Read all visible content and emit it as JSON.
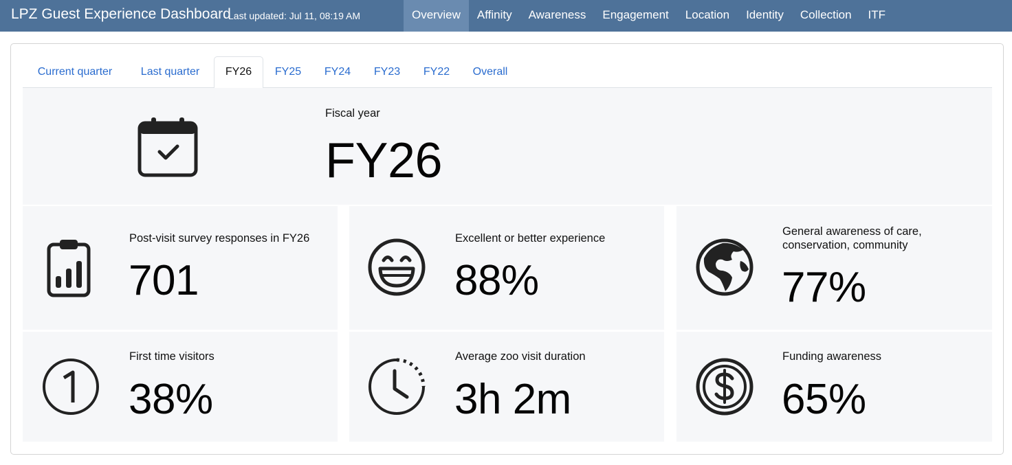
{
  "app": {
    "title": "LPZ Guest Experience Dashboard",
    "last_updated": "Last updated: Jul 11, 08:19 AM"
  },
  "nav": {
    "items": [
      {
        "label": "Overview",
        "active": true
      },
      {
        "label": "Affinity"
      },
      {
        "label": "Awareness"
      },
      {
        "label": "Engagement"
      },
      {
        "label": "Location"
      },
      {
        "label": "Identity"
      },
      {
        "label": "Collection"
      },
      {
        "label": "ITF"
      }
    ]
  },
  "tabs": [
    {
      "label": "Current quarter"
    },
    {
      "label": "Last quarter"
    },
    {
      "label": "FY26",
      "active": true
    },
    {
      "label": "FY25"
    },
    {
      "label": "FY24"
    },
    {
      "label": "FY23"
    },
    {
      "label": "FY22"
    },
    {
      "label": "Overall"
    }
  ],
  "fiscal": {
    "label": "Fiscal year",
    "value": "FY26",
    "icon": "calendar-check-icon"
  },
  "metrics": [
    {
      "label": "Post-visit survey responses in FY26",
      "value": "701",
      "icon": "clipboard-chart-icon"
    },
    {
      "label": "Excellent or better experience",
      "value": "88%",
      "icon": "grinning-face-icon"
    },
    {
      "label": "General awareness of care, conservation, community",
      "value": "77%",
      "icon": "globe-americas-icon"
    },
    {
      "label": "First time visitors",
      "value": "38%",
      "icon": "circled-one-icon"
    },
    {
      "label": "Average zoo visit duration",
      "value": "3h 2m",
      "icon": "clock-icon"
    },
    {
      "label": "Funding awareness",
      "value": "65%",
      "icon": "dollar-coin-icon"
    }
  ],
  "colors": {
    "topbar": "#4e7299",
    "topbar_active": "#6a8bb0",
    "link": "#2a6ccf",
    "card_bg": "#f6f7f9",
    "icon": "#222222"
  }
}
